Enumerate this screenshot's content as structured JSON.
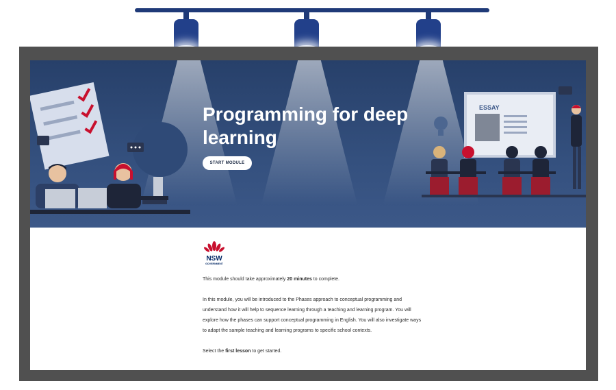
{
  "hero": {
    "title": "Programming for deep learning",
    "start_label": "START MODULE",
    "essay_label": "ESSAY"
  },
  "logo": {
    "text": "NSW",
    "subtext": "GOVERNMENT"
  },
  "intro": {
    "duration_prefix": "This module should take approximately ",
    "duration_value": "20 minutes",
    "duration_suffix": " to complete.",
    "body": "In this module, you will be introduced to the Phases approach to conceptual programming and understand how it will help to sequence learning through a teaching and learning program. You will explore how the phases can support conceptual programming in English. You will also investigate ways to adapt the sample teaching and learning programs to specific school contexts.",
    "cta_prefix": "Select the ",
    "cta_value": "first lesson",
    "cta_suffix": " to get started."
  },
  "colors": {
    "hero_bg": "#34507e",
    "lamp": "#1f3a78",
    "frame": "#505050",
    "accent_red": "#c8102e"
  }
}
